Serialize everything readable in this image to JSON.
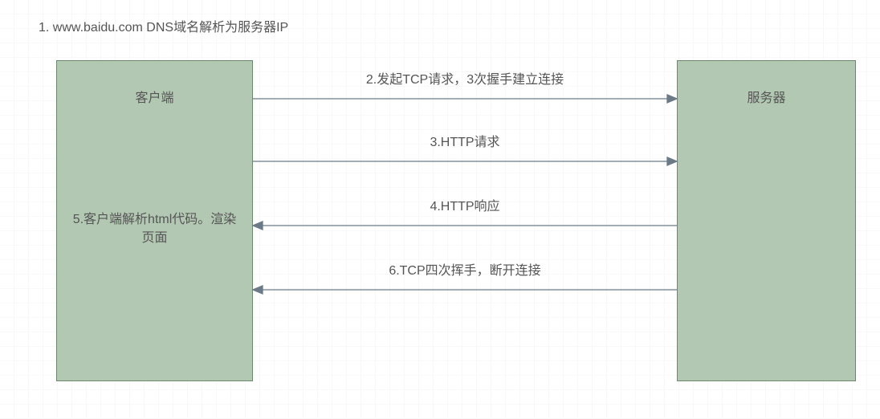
{
  "title": "1. www.baidu.com DNS域名解析为服务器IP",
  "client": {
    "label": "客户端",
    "body": "5.客户端解析html代码。渲染页面"
  },
  "server": {
    "label": "服务器"
  },
  "arrows": {
    "a1": {
      "label": "2.发起TCP请求，3次握手建立连接"
    },
    "a2": {
      "label": "3.HTTP请求"
    },
    "a3": {
      "label": "4.HTTP响应"
    },
    "a4": {
      "label": "6.TCP四次挥手，断开连接"
    }
  }
}
